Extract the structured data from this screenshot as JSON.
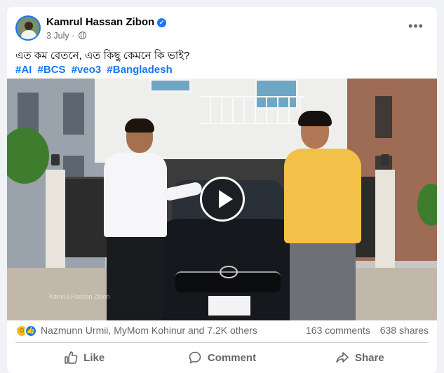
{
  "post": {
    "author": "Kamrul Hassan Zibon",
    "date": "3 July",
    "separator": "·",
    "caption": "এত কম বেতনে, এত কিছু কেমনে কি ভাই?",
    "hashtags": [
      "#AI",
      "#BCS",
      "#veo3",
      "#Bangladesh"
    ]
  },
  "video": {
    "watermark": "Kamrul Hassan Zibon"
  },
  "stats": {
    "reactions_text": "Nazmunn Urmii, MyMom Kohinur and 7.2K others",
    "comments": "163 comments",
    "shares": "638 shares"
  },
  "actions": {
    "like": "Like",
    "comment": "Comment",
    "share": "Share"
  },
  "icons": {
    "verified": "verified-badge-icon",
    "audience": "globe-icon",
    "more": "more-options-icon",
    "play": "play-icon",
    "reactions": [
      "haha-reaction-icon",
      "like-reaction-icon"
    ]
  },
  "colors": {
    "accent": "#1877f2",
    "muted": "#65676b",
    "background": "#f0f2f5"
  }
}
